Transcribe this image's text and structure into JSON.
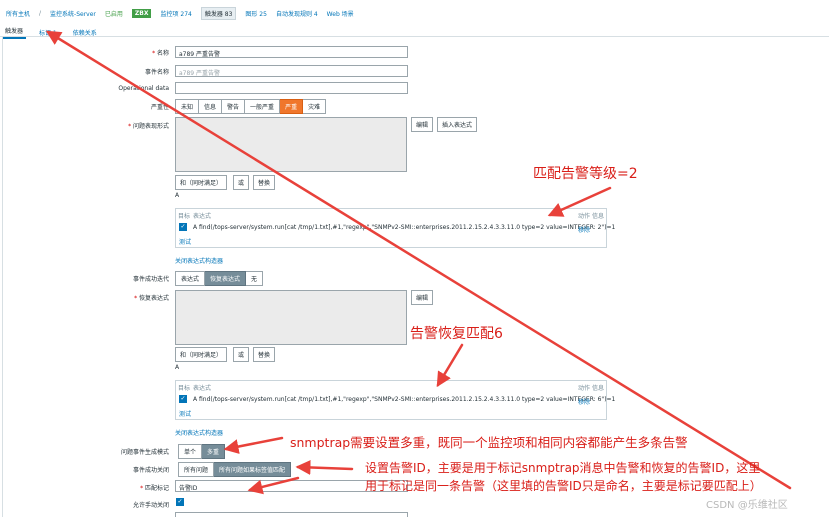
{
  "breadcrumb": {
    "all_hosts": "所有主机",
    "host": "监控系统-Server",
    "status": "已启用",
    "zbx": "ZBX",
    "items": "监控项 274",
    "triggers": "触发器 83",
    "graphs": "图形 25",
    "discovery": "自动发现规则 4",
    "web": "Web 场景"
  },
  "tabs": [
    {
      "label": "触发器"
    },
    {
      "label": "标记 1"
    },
    {
      "label": "依赖关系"
    }
  ],
  "form": {
    "name_label": "名称",
    "name_value": "a789 严重告警",
    "event_name_label": "事件名称",
    "event_name_placeholder": "a789 严重告警",
    "opdata_label": "Operational data",
    "severity_label": "严重性",
    "severities": [
      "未知",
      "信息",
      "警告",
      "一般严重",
      "严重",
      "灾难"
    ],
    "severity_selected": "严重",
    "problem_expr_label": "问题表现形式",
    "edit_btn": "编辑",
    "insert_expr_btn": "插入表达式",
    "and_btn": "和（同时满足）",
    "or_btn": "或",
    "replace_btn": "替换",
    "expr_letter": "A",
    "col_target": "目标",
    "col_expr": "表达式",
    "col_action": "动作",
    "col_info": "信息",
    "problem_expr_text": "A  find(/tops-server/system.run[cat /tmp/1.txt],#1,\"regexp\",\"SNMPv2-SMI::enterprises.2011.2.15.2.4.3.3.11.0 type=2 value=INTEGER: 2\")=1",
    "remove_link": "移除",
    "test_link": "测试",
    "close_builder": "关闭表达式构造器",
    "ok_event_gen_label": "事件成功迭代",
    "ok_event_gen_options": [
      "表达式",
      "恢复表达式",
      "无"
    ],
    "ok_event_gen_selected": "恢复表达式",
    "recovery_expr_label": "恢复表达式",
    "recovery_expr_text": "A  find(/tops-server/system.run[cat /tmp/1.txt],#1,\"regexp\",\"SNMPv2-SMI::enterprises.2011.2.15.2.4.3.3.11.0 type=2 value=INTEGER: 6\")=1",
    "problem_mode_label": "问题事件生成模式",
    "problem_mode_options": [
      "单个",
      "多重"
    ],
    "problem_mode_selected": "多重",
    "ok_close_label": "事件成功关闭",
    "ok_close_options": [
      "所有问题",
      "所有问题如果标签值匹配"
    ],
    "ok_close_selected": "所有问题如果标签值匹配",
    "tag_match_label": "匹配标记",
    "tag_match_value": "告警ID",
    "manual_close_label": "允许手动关闭"
  },
  "annotations": {
    "note1": "匹配告警等级=2",
    "note2": "告警恢复匹配6",
    "note3": "snmptrap需要设置多重，既同一个监控项和相同内容都能产生多条告警",
    "note4_line1": "设置告警ID，主要是用于标记snmptrap消息中告警和恢复的告警ID，这里",
    "note4_line2": "用于标记是同一条告警（这里填的告警ID只是命名，主要是标记要匹配上）"
  },
  "watermark": "CSDN @乐维社区",
  "colors": {
    "accent": "#0275b8",
    "severity_high": "#f0762b",
    "annotation_red": "#d91e18"
  }
}
